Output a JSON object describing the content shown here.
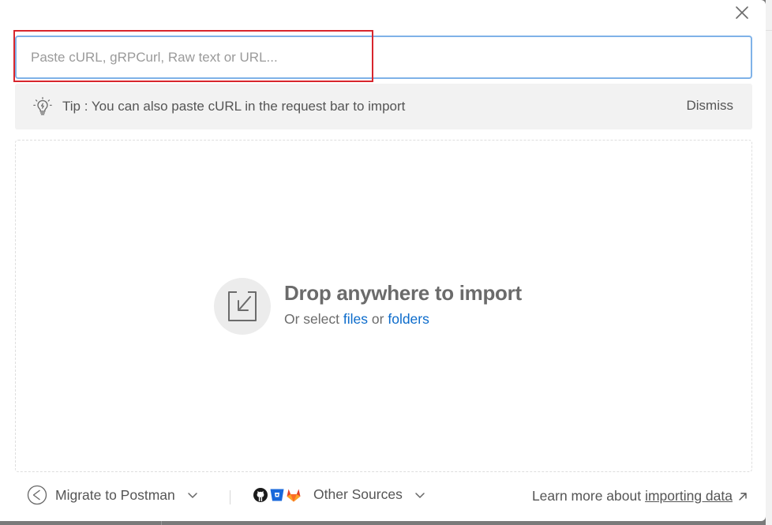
{
  "import_modal": {
    "input": {
      "placeholder": "Paste cURL, gRPCurl, Raw text or URL...",
      "value": ""
    },
    "tip": {
      "text": "Tip : You can also paste cURL in the request bar to import",
      "dismiss_label": "Dismiss"
    },
    "drop_zone": {
      "title": "Drop anywhere to import",
      "subtitle_prefix": "Or select",
      "files_link": "files",
      "conjunction": "or",
      "folders_link": "folders"
    },
    "footer": {
      "migrate_label": "Migrate to Postman",
      "other_sources_label": "Other Sources",
      "learn_more_prefix": "Learn more about",
      "learn_more_link": "importing data"
    },
    "icons": [
      "close-icon",
      "lightbulb-icon",
      "import-download-icon",
      "postman-migrate-icon",
      "chevron-down-icon",
      "github-icon",
      "bitbucket-icon",
      "gitlab-icon",
      "external-link-icon"
    ],
    "colors": {
      "input_focus_border": "#7fb2e8",
      "highlight_border": "#d8262d",
      "link": "#0b6bcb",
      "tip_background": "#f2f2f2",
      "text_muted": "#555555"
    }
  }
}
